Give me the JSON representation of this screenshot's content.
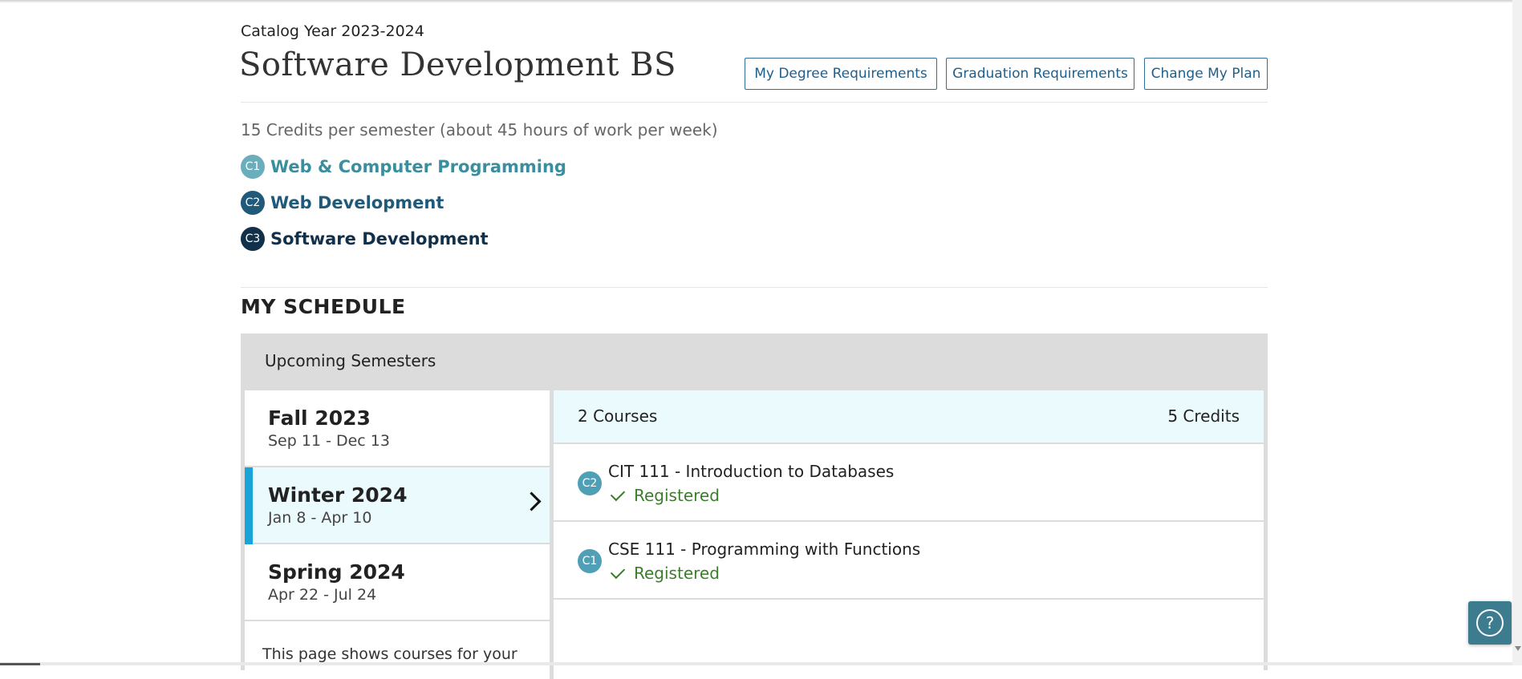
{
  "header": {
    "catalog_year": "Catalog Year 2023-2024",
    "program_title": "Software Development BS",
    "buttons": [
      "My Degree Requirements",
      "Graduation Requirements",
      "Change My Plan"
    ]
  },
  "credits_note": "15 Credits per semester (about 45 hours of work per week)",
  "certificates": [
    {
      "badge": "C1",
      "name": "Web & Computer Programming",
      "color": "#3a8e9e",
      "badge_color": "#6aadbd"
    },
    {
      "badge": "C2",
      "name": "Web Development",
      "color": "#1f5a7a",
      "badge_color": "#1f5a7a"
    },
    {
      "badge": "C3",
      "name": "Software Development",
      "color": "#12304a",
      "badge_color": "#12304a"
    }
  ],
  "schedule": {
    "title": "MY SCHEDULE",
    "panel_title": "Upcoming Semesters",
    "terms": [
      {
        "name": "Fall 2023",
        "dates": "Sep 11 - Dec 13"
      },
      {
        "name": "Winter 2024",
        "dates": "Jan 8 - Apr 10",
        "active": true
      },
      {
        "name": "Spring 2024",
        "dates": "Apr 22 - Jul 24"
      }
    ],
    "terms_note": "This page shows courses for your",
    "summary": {
      "courses": "2 Courses",
      "credits": "5 Credits"
    },
    "courses": [
      {
        "badge": "C2",
        "name": "CIT 111 - Introduction to Databases",
        "status": "Registered"
      },
      {
        "badge": "C1",
        "name": "CSE 111 - Programming with Functions",
        "status": "Registered"
      }
    ]
  },
  "help": {
    "icon": "help-icon",
    "symbol": "?"
  }
}
